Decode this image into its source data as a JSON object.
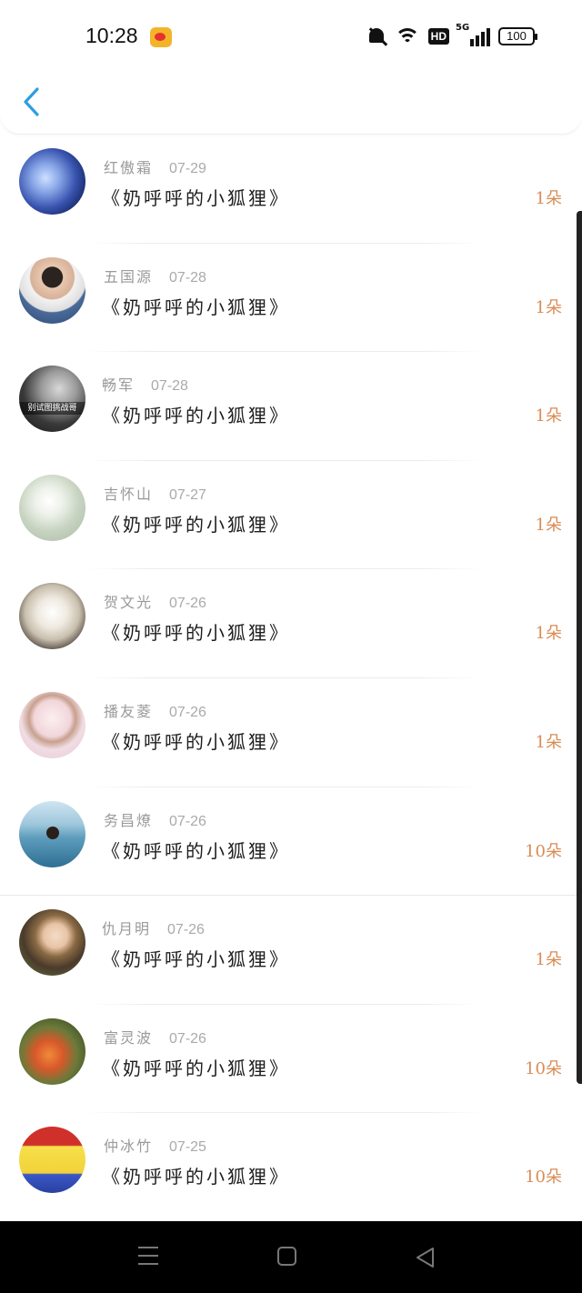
{
  "status_bar": {
    "time": "10:28",
    "network_label": "5G",
    "hd_label": "HD",
    "battery": "100"
  },
  "header": {
    "back_icon": "chevron-left-icon",
    "accent_color": "#2d9ee0"
  },
  "list": {
    "count_color": "#d98c55",
    "items": [
      {
        "name": "红傲霜",
        "date": "07-29",
        "gift": "《奶呼呼的小狐狸》",
        "count": "1朵"
      },
      {
        "name": "五国源",
        "date": "07-28",
        "gift": "《奶呼呼的小狐狸》",
        "count": "1朵"
      },
      {
        "name": "畅军",
        "date": "07-28",
        "gift": "《奶呼呼的小狐狸》",
        "count": "1朵",
        "avatar_caption": "别试图挑战哥"
      },
      {
        "name": "吉怀山",
        "date": "07-27",
        "gift": "《奶呼呼的小狐狸》",
        "count": "1朵"
      },
      {
        "name": "贺文光",
        "date": "07-26",
        "gift": "《奶呼呼的小狐狸》",
        "count": "1朵"
      },
      {
        "name": "播友菱",
        "date": "07-26",
        "gift": "《奶呼呼的小狐狸》",
        "count": "1朵"
      },
      {
        "name": "务昌燎",
        "date": "07-26",
        "gift": "《奶呼呼的小狐狸》",
        "count": "10朵"
      },
      {
        "name": "仇月明",
        "date": "07-26",
        "gift": "《奶呼呼的小狐狸》",
        "count": "1朵"
      },
      {
        "name": "富灵波",
        "date": "07-26",
        "gift": "《奶呼呼的小狐狸》",
        "count": "10朵"
      },
      {
        "name": "仲冰竹",
        "date": "07-25",
        "gift": "《奶呼呼的小狐狸》",
        "count": "10朵"
      }
    ]
  },
  "nav_bar": {
    "icons": [
      "menu-icon",
      "home-icon",
      "back-triangle-icon"
    ]
  }
}
